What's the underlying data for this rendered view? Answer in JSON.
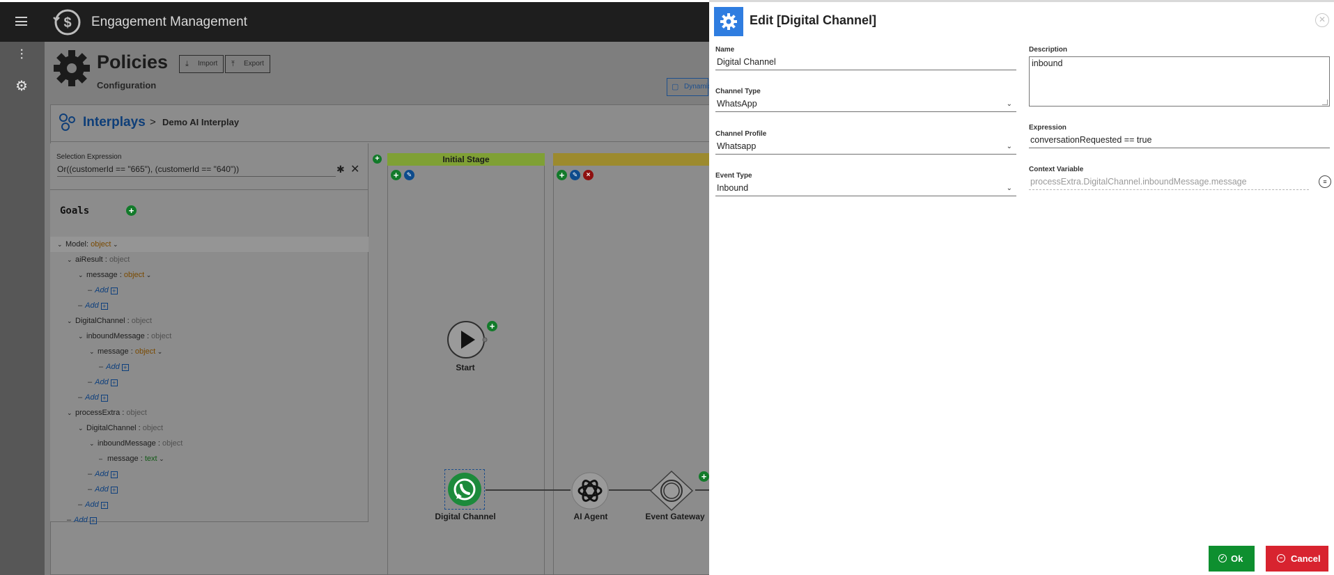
{
  "app": {
    "title": "Engagement Management"
  },
  "page": {
    "title": "Policies",
    "subtitle": "Configuration",
    "import_label": "Import",
    "export_label": "Export",
    "dynamic_label": "Dynamic"
  },
  "breadcrumb": {
    "root": "Interplays",
    "separator": ">",
    "current": "Demo AI Interplay"
  },
  "selection": {
    "label": "Selection Expression",
    "value": "Or((customerId == \"665\"), (customerId == \"640\"))"
  },
  "goals": {
    "title": "Goals",
    "tree": [
      {
        "kind": "node",
        "label": "Model",
        "sep": ":",
        "type": "object",
        "type_class": "obj"
      },
      {
        "kind": "node",
        "label": "aiResult",
        "sep": " :",
        "type": "object",
        "type_class": ""
      },
      {
        "kind": "node",
        "label": "message",
        "sep": " :",
        "type": "object",
        "type_class": "obj"
      },
      {
        "kind": "add",
        "label": "Add"
      },
      {
        "kind": "add",
        "label": "Add"
      },
      {
        "kind": "node",
        "label": "DigitalChannel",
        "sep": " :",
        "type": "object",
        "type_class": ""
      },
      {
        "kind": "node",
        "label": "inboundMessage",
        "sep": " :",
        "type": "object",
        "type_class": ""
      },
      {
        "kind": "node",
        "label": "message",
        "sep": " :",
        "type": "object",
        "type_class": "obj"
      },
      {
        "kind": "add",
        "label": "Add"
      },
      {
        "kind": "add",
        "label": "Add"
      },
      {
        "kind": "add",
        "label": "Add"
      },
      {
        "kind": "node",
        "label": "processExtra",
        "sep": " :",
        "type": "object",
        "type_class": ""
      },
      {
        "kind": "node",
        "label": "DigitalChannel",
        "sep": " :",
        "type": "object",
        "type_class": ""
      },
      {
        "kind": "node",
        "label": "inboundMessage",
        "sep": " :",
        "type": "object",
        "type_class": ""
      },
      {
        "kind": "leaf",
        "label": "message",
        "sep": " :",
        "type": "text",
        "type_class": "txt"
      },
      {
        "kind": "add",
        "label": "Add"
      },
      {
        "kind": "add",
        "label": "Add"
      },
      {
        "kind": "add",
        "label": "Add"
      },
      {
        "kind": "add",
        "label": "Add"
      }
    ]
  },
  "canvas": {
    "stage1": "Initial Stage",
    "stage1_color": "#7fa035",
    "stage2_color": "#9c8a2e",
    "start_label": "Start",
    "nodes": [
      "Digital Channel",
      "AI Agent",
      "Event Gateway"
    ]
  },
  "dialog": {
    "title": "Edit [Digital Channel]",
    "name_label": "Name",
    "name_value": "Digital Channel",
    "channel_type_label": "Channel Type",
    "channel_type_value": "WhatsApp",
    "channel_profile_label": "Channel Profile",
    "channel_profile_value": "Whatsapp",
    "event_type_label": "Event Type",
    "event_type_value": "Inbound",
    "description_label": "Description",
    "description_value": "inbound",
    "expression_label": "Expression",
    "expression_value": "conversationRequested == true",
    "context_label": "Context Variable",
    "context_value": "processExtra.DigitalChannel.inboundMessage.message",
    "ok_label": "Ok",
    "cancel_label": "Cancel"
  },
  "colors": {
    "ok": "#0e8f2f",
    "cancel": "#d8232f",
    "accent": "#2f7de0"
  },
  "icons": [
    "menu-icon",
    "logo-icon",
    "filters-icon",
    "settings-icon",
    "gear-icon",
    "import-icon",
    "export-icon",
    "calendar-icon",
    "interplay-icon",
    "puzzle-icon",
    "clear-icon",
    "play-icon",
    "whatsapp-icon",
    "openai-icon",
    "gateway-icon",
    "close-icon",
    "check-icon",
    "minus-icon"
  ]
}
